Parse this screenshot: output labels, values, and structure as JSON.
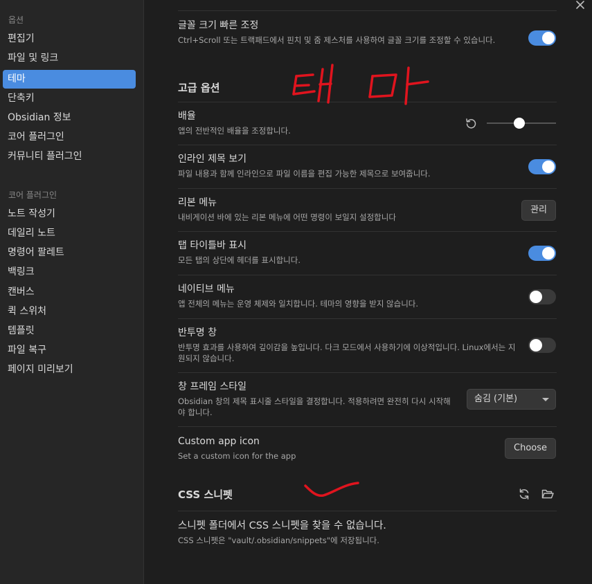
{
  "sidebar": {
    "section1_heading": "옵션",
    "options": [
      {
        "label": "편집기"
      },
      {
        "label": "파일 및 링크"
      },
      {
        "label": "테마"
      },
      {
        "label": "단축키"
      },
      {
        "label": "Obsidian 정보"
      },
      {
        "label": "코어 플러그인"
      },
      {
        "label": "커뮤니티 플러그인"
      }
    ],
    "section2_heading": "코어 플러그인",
    "plugins": [
      {
        "label": "노트 작성기"
      },
      {
        "label": "데일리 노트"
      },
      {
        "label": "명령어 팔레트"
      },
      {
        "label": "백링크"
      },
      {
        "label": "캔버스"
      },
      {
        "label": "퀵 스위처"
      },
      {
        "label": "템플릿"
      },
      {
        "label": "파일 복구"
      },
      {
        "label": "페이지 미리보기"
      }
    ]
  },
  "main": {
    "font_scroll": {
      "name": "글꼴 크기 빠른 조정",
      "desc": "Ctrl+Scroll 또는 트랙패드에서 핀치 및 줌 제스처를 사용하여 글꼴 크기를 조정할 수 있습니다.",
      "enabled": true
    },
    "advanced_heading": "고급 옵션",
    "zoom": {
      "name": "배율",
      "desc": "앱의 전반적인 배율을 조정합니다.",
      "level": 0.47
    },
    "inline_title": {
      "name": "인라인 제목 보기",
      "desc": "파일 내용과 함께 인라인으로 파일 이름을 편집 가능한 제목으로 보여줍니다.",
      "enabled": true
    },
    "ribbon_menu": {
      "name": "리본 메뉴",
      "desc": "내비게이션 바에 있는 리본 메뉴에 어떤 명령이 보일지 설정합니다",
      "button": "관리"
    },
    "tab_titlebar": {
      "name": "탭 타이틀바 표시",
      "desc": "모든 탭의 상단에 헤더를 표시합니다.",
      "enabled": true
    },
    "native_menu": {
      "name": "네이티브 메뉴",
      "desc": "앱 전체의 메뉴는 운영 체제와 일치합니다. 테마의 영향을 받지 않습니다.",
      "enabled": false
    },
    "translucent": {
      "name": "반투명 창",
      "desc": "반투명 효과를 사용하여 깊이감을 높입니다. 다크 모드에서 사용하기에 이상적입니다. Linux에서는 지원되지 않습니다.",
      "enabled": false
    },
    "frame_style": {
      "name": "창 프레임 스타일",
      "desc": "Obsidian 창의 제목 표시줄 스타일을 결정합니다. 적용하려면 완전히 다시 시작해야 합니다.",
      "selected": "숨김 (기본)"
    },
    "app_icon": {
      "name": "Custom app icon",
      "desc": "Set a custom icon for the app",
      "button": "Choose"
    },
    "css_heading": "CSS 스니펫",
    "css_empty": {
      "name": "스니펫 폴더에서 CSS 스니펫을 찾을 수 없습니다.",
      "desc": "CSS 스니펫은 \"vault/.obsidian/snippets\"에 저장됩니다."
    }
  },
  "colors": {
    "accent": "#4a8ce0",
    "annotation": "#e0141e"
  }
}
